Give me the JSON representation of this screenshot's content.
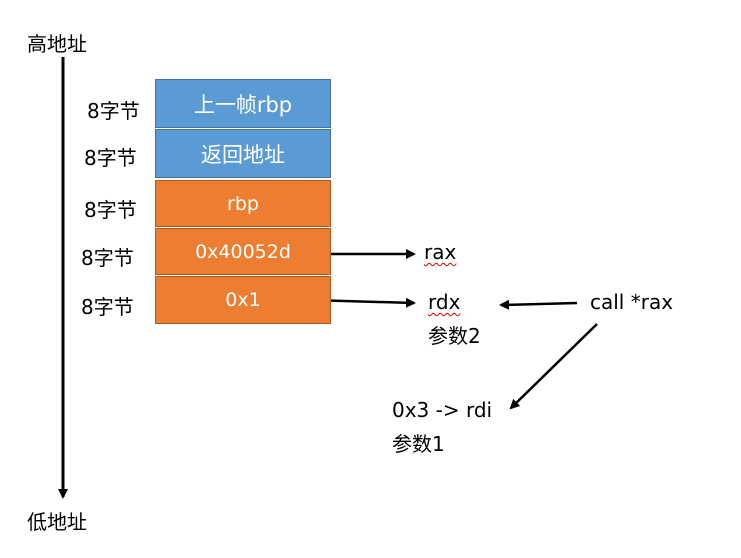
{
  "axis": {
    "top_label": "高地址",
    "bottom_label": "低地址"
  },
  "stack": [
    {
      "size": "8字节",
      "content": "上一帧rbp",
      "color": "#5b9bd5"
    },
    {
      "size": "8字节",
      "content": "返回地址",
      "color": "#5b9bd5"
    },
    {
      "size": "8字节",
      "content": "rbp",
      "color": "#ed7d31"
    },
    {
      "size": "8字节",
      "content": "0x40052d",
      "color": "#ed7d31"
    },
    {
      "size": "8字节",
      "content": "0x1",
      "color": "#ed7d31"
    }
  ],
  "annotations": {
    "rax": "rax",
    "rdx": "rdx",
    "rdx_note": "参数2",
    "call": "call *rax",
    "rdi": "0x3 -> rdi",
    "rdi_note": "参数1"
  }
}
